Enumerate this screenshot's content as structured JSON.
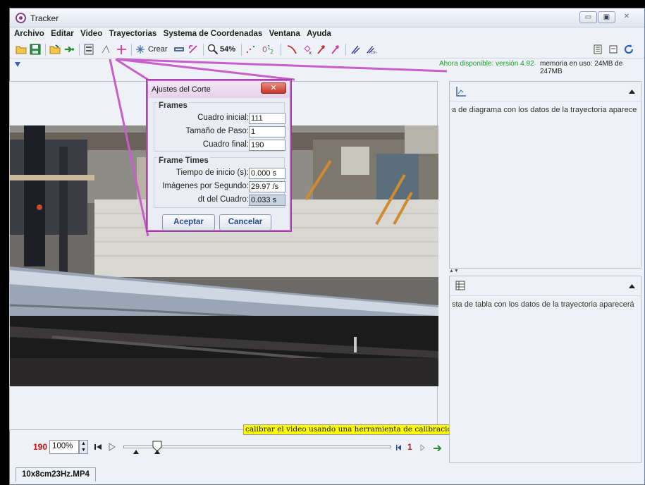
{
  "window": {
    "title": "Tracker",
    "minimize_glyph": "▭",
    "maximize_glyph": "▣",
    "close_glyph": "✕"
  },
  "menu": [
    "Archivo",
    "Editar",
    "Video",
    "Trayectorias",
    "Systema de Coordenadas",
    "Ventana",
    "Ayuda"
  ],
  "toolbar": {
    "create_label": "Crear",
    "zoom_label": "54%"
  },
  "info": {
    "update_text": "Ahora disponible: versión 4.92",
    "memory_text": "memoria en uso: 24MB de 247MB"
  },
  "dialog": {
    "title": "Ajustes del Corte",
    "close_glyph": "✕",
    "frames_group": "Frames",
    "start_frame_label": "Cuadro inicial:",
    "start_frame_value": "111",
    "step_size_label": "Tamaño de Paso:",
    "step_size_value": "1",
    "end_frame_label": "Cuadro final:",
    "end_frame_value": "190",
    "times_group": "Frame Times",
    "start_time_label": "Tiempo de inicio (s):",
    "start_time_value": "0.000 s",
    "fps_label": "Imágenes por Segundo:",
    "fps_value": "29.97 /s",
    "dt_label": "dt del Cuadro:",
    "dt_value": "0.033 s",
    "accept_label": "Aceptar",
    "cancel_label": "Cancelar"
  },
  "video": {
    "calibration_note": "calibrar el video usando una herramienta de calibración"
  },
  "player": {
    "frame_number": "190",
    "zoom_value": "100%",
    "step_number": "1"
  },
  "plot_panel": {
    "message": "a de diagrama con los datos de la trayectoria aparece"
  },
  "table_panel": {
    "message": "sta de tabla con los datos de la trayectoria aparecerá"
  },
  "file_tab": "10x8cm23Hz.MP4",
  "colors": {
    "accent_purple": "#c85ecb",
    "update_green": "#1c9a2e",
    "note_yellow": "#ffff00",
    "frame_red": "#cc1111"
  }
}
